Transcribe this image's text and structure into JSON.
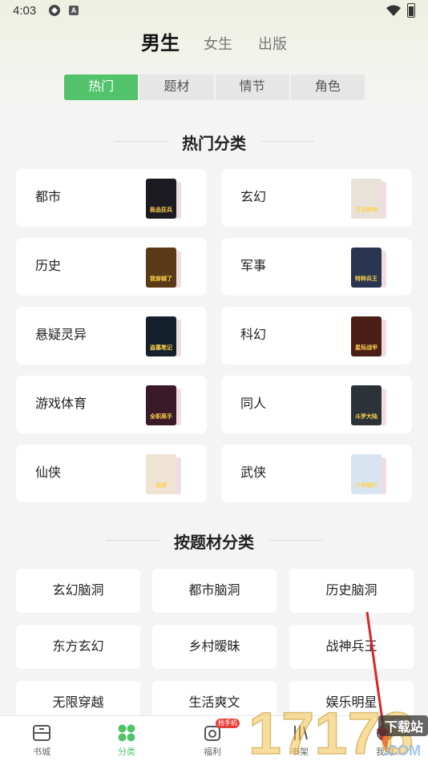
{
  "status_bar": {
    "time": "4:03",
    "icon2_letter": "A"
  },
  "gender_tabs": [
    {
      "label": "男生",
      "active": true
    },
    {
      "label": "女生",
      "active": false
    },
    {
      "label": "出版",
      "active": false
    }
  ],
  "segment_tabs": [
    {
      "label": "热门",
      "active": true
    },
    {
      "label": "题材",
      "active": false
    },
    {
      "label": "情节",
      "active": false
    },
    {
      "label": "角色",
      "active": false
    }
  ],
  "hot_section": {
    "title": "热门分类",
    "categories": [
      {
        "name": "都市",
        "cover_text": "极品狂兵",
        "cover_color": "#1d1b22"
      },
      {
        "name": "玄幻",
        "cover_text": "万古神帝",
        "cover_color": "#e8e2d8"
      },
      {
        "name": "历史",
        "cover_text": "我穿越了",
        "cover_color": "#5a3a17"
      },
      {
        "name": "军事",
        "cover_text": "特种兵王",
        "cover_color": "#2a3550"
      },
      {
        "name": "悬疑灵异",
        "cover_text": "盗墓笔记",
        "cover_color": "#14202c"
      },
      {
        "name": "科幻",
        "cover_text": "星际战甲",
        "cover_color": "#4a1f15"
      },
      {
        "name": "游戏体育",
        "cover_text": "全职高手",
        "cover_color": "#3a1a28"
      },
      {
        "name": "同人",
        "cover_text": "斗罗大陆",
        "cover_color": "#2c3338"
      },
      {
        "name": "仙侠",
        "cover_text": "剑来",
        "cover_color": "#efe3d4"
      },
      {
        "name": "武侠",
        "cover_text": "少年歌行",
        "cover_color": "#d8e4f0"
      }
    ]
  },
  "subject_section": {
    "title": "按题材分类",
    "chips": [
      "玄幻脑洞",
      "都市脑洞",
      "历史脑洞",
      "东方玄幻",
      "乡村暧昧",
      "战神兵王",
      "无限穿越",
      "生活爽文",
      "娱乐明星"
    ]
  },
  "bottom_nav": [
    {
      "label": "书城",
      "icon": "bookstore-icon",
      "active": false
    },
    {
      "label": "分类",
      "icon": "category-icon",
      "active": true
    },
    {
      "label": "福利",
      "icon": "gift-icon",
      "active": false,
      "badge": "抢手机"
    },
    {
      "label": "书架",
      "icon": "bookshelf-icon",
      "active": false
    },
    {
      "label": "我的",
      "icon": "profile-icon",
      "active": false
    }
  ],
  "watermark": {
    "text": "17178",
    "sub": "下载站",
    "domain": ".COM"
  },
  "colors": {
    "accent": "#52c36a",
    "badge": "#e8403a",
    "background": "#f4f4f4",
    "arrow": "#d9262a"
  }
}
